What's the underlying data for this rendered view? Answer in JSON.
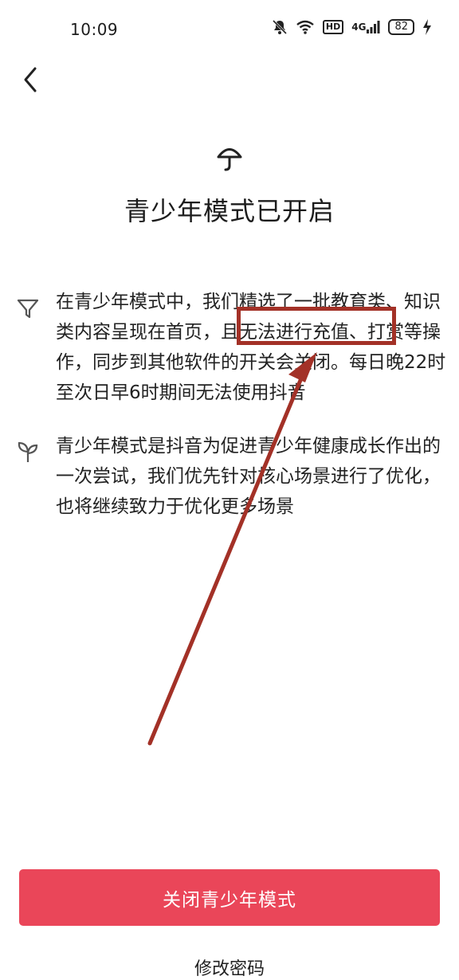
{
  "status_bar": {
    "time": "10:09",
    "hd_label": "HD",
    "network_label": "4G",
    "battery_level": "82"
  },
  "page": {
    "title": "青少年模式已开启",
    "paragraph_1": "在青少年模式中，我们精选了一批教育类、知识类内容呈现在首页，且无法进行充值、打赏等操作，同步到其他软件的开关会关闭。每日晚22时至次日早6时期间无法使用抖音",
    "paragraph_2": "青少年模式是抖音为促进青少年健康成长作出的一次尝试，我们优先针对核心场景进行了优化，也将继续致力于优化更多场景"
  },
  "actions": {
    "close_button_label": "关闭青少年模式",
    "change_password_label": "修改密码"
  },
  "colors": {
    "primary": "#ea4659",
    "annotation": "#a33127"
  },
  "icons": [
    "back-icon",
    "umbrella-icon",
    "filter-icon",
    "sprout-icon",
    "mute-icon",
    "wifi-icon",
    "signal-icon",
    "charging-icon"
  ]
}
